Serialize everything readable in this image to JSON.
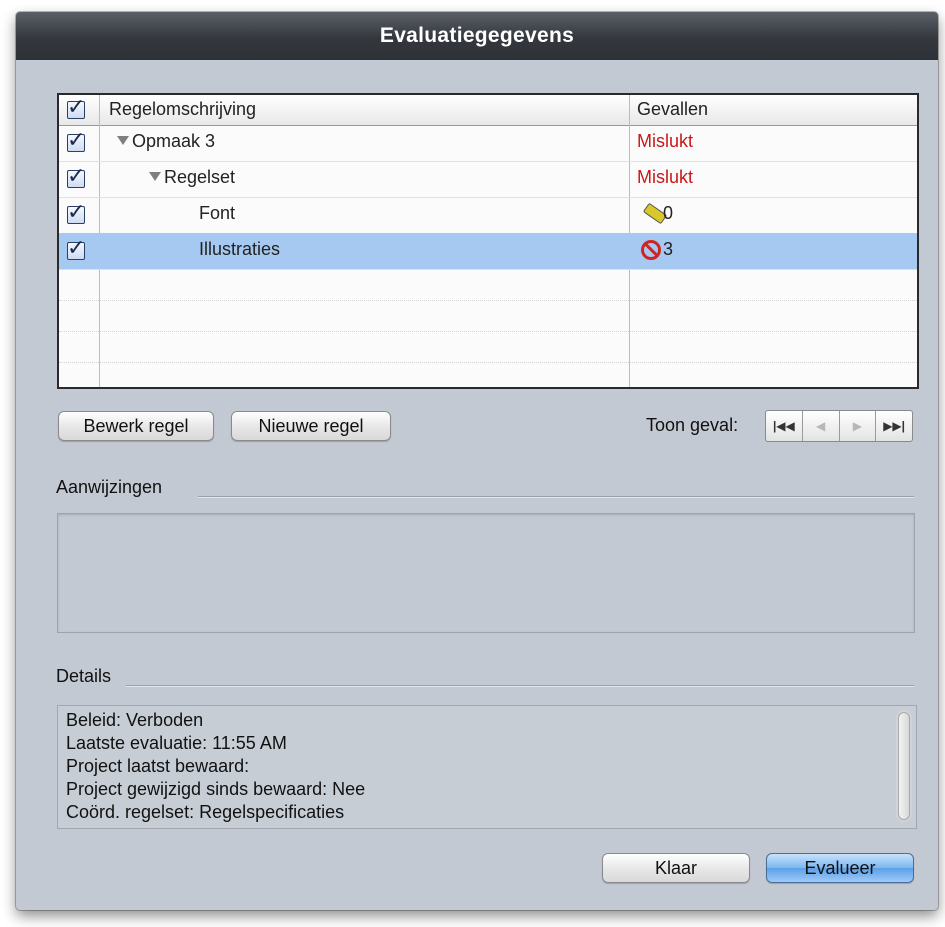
{
  "window": {
    "title": "Evaluatiegegevens"
  },
  "table": {
    "columns": [
      "Regelomschrijving",
      "Gevallen"
    ],
    "rows": [
      {
        "name": "Opmaak 3",
        "indent": 0,
        "disclosure": "open",
        "status": "Mislukt",
        "status_color": "#c81818",
        "checked": true
      },
      {
        "name": "Regelset",
        "indent": 1,
        "disclosure": "open",
        "status": "Mislukt",
        "status_color": "#c81818",
        "checked": true
      },
      {
        "name": "Font",
        "indent": 2,
        "icon": "pencil-icon",
        "count": "0",
        "checked": true
      },
      {
        "name": "Illustraties",
        "indent": 2,
        "icon": "forbidden-icon",
        "count": "3",
        "checked": true,
        "selected": true
      }
    ]
  },
  "buttons": {
    "edit_rule": "Bewerk regel",
    "new_rule": "Nieuwe regel",
    "done": "Klaar",
    "evaluate": "Evalueer"
  },
  "navigation": {
    "label": "Toon geval:",
    "controls": [
      "first-icon",
      "previous-icon",
      "next-icon",
      "last-icon"
    ]
  },
  "hints": {
    "label": "Aanwijzingen",
    "text": ""
  },
  "details": {
    "label": "Details",
    "lines": [
      "Beleid: Verboden",
      "Laatste evaluatie: 11:55 AM",
      "Project laatst bewaard:",
      "Project gewijzigd sinds bewaard: Nee",
      "Coörd. regelset: Regelspecificaties"
    ]
  },
  "colors": {
    "selection": "#a6c9f1",
    "failed": "#c81818",
    "accent_button": "#5ba0ea"
  }
}
